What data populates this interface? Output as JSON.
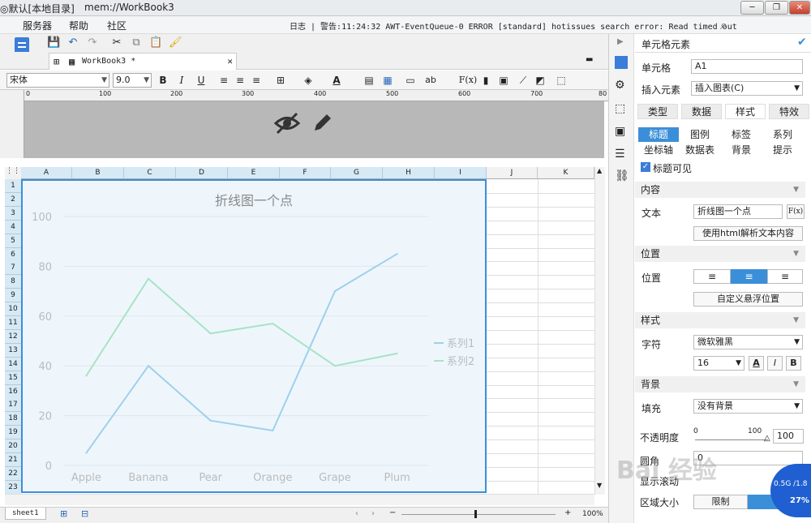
{
  "window": {
    "title": "◎默认[本地目录]",
    "path": "mem://WorkBook3"
  },
  "menu": {
    "items": [
      "服务器",
      "帮助",
      "社区"
    ],
    "log": "日志 | 警告:11:24:32 AWT-EventQueue-0 ERROR [standard] hotissues search error: Read timed out"
  },
  "tab": {
    "label": "WorkBook3 *"
  },
  "format": {
    "font": "宋体",
    "size": "9.0",
    "bold": "B",
    "italic": "I",
    "underline": "U",
    "text_color_label": "A",
    "ab_label": "ab",
    "formula_label": "F(x)"
  },
  "ruler": {
    "ticks": [
      "0",
      "100",
      "200",
      "300",
      "400",
      "500",
      "600",
      "700",
      "80"
    ]
  },
  "columns": [
    "A",
    "B",
    "C",
    "D",
    "E",
    "F",
    "G",
    "H",
    "I",
    "J",
    "K"
  ],
  "rows": [
    "1",
    "2",
    "3",
    "4",
    "5",
    "6",
    "7",
    "8",
    "9",
    "10",
    "11",
    "12",
    "13",
    "14",
    "15",
    "16",
    "17",
    "18",
    "19",
    "20",
    "21",
    "22",
    "23"
  ],
  "status": {
    "sheet_name": "sheet1",
    "zoom": "100%"
  },
  "colors": {
    "accent": "#3b8fd8",
    "series1": "#9fd0ec",
    "series2": "#a7e3c4",
    "selected_tab": "#3b8fd8"
  },
  "chart_data": {
    "type": "line",
    "title": "折线图一个点",
    "categories": [
      "Apple",
      "Banana",
      "Pear",
      "Orange",
      "Grape",
      "Plum"
    ],
    "series": [
      {
        "name": "系列1",
        "values": [
          5,
          40,
          18,
          14,
          70,
          85
        ]
      },
      {
        "name": "系列2",
        "values": [
          36,
          75,
          53,
          57,
          40,
          45
        ]
      }
    ],
    "ylim": [
      0,
      100
    ],
    "yticks": [
      "0",
      "20",
      "40",
      "60",
      "80",
      "100"
    ],
    "grid": true,
    "legend": "right"
  },
  "panel": {
    "title": "单元格元素",
    "cell_label": "单元格",
    "cell_value": "A1",
    "insert_label": "插入元素",
    "insert_value": "插入图表(C)",
    "main_tabs": [
      "类型",
      "数据",
      "样式",
      "特效"
    ],
    "sub_tabs": [
      "标题",
      "图例",
      "标签",
      "系列",
      "坐标轴",
      "数据表",
      "背景",
      "提示"
    ],
    "title_visible": "标题可见",
    "content_section": "内容",
    "text_label": "文本",
    "text_value": "折线图一个点",
    "fx_label": "F(x)",
    "html_button": "使用html解析文本内容",
    "position_section": "位置",
    "position_label": "位置",
    "custom_pos_button": "自定义悬浮位置",
    "style_section": "样式",
    "char_label": "字符",
    "font_value": "微软雅黑",
    "size_value": "16",
    "color_btn": "A",
    "italic_btn": "I",
    "bold_btn": "B",
    "bg_section": "背景",
    "fill_label": "填充",
    "fill_value": "没有背景",
    "opacity_label": "不透明度",
    "opacity_min": "0",
    "opacity_max": "100",
    "opacity_value": "100",
    "corner_label": "圆角",
    "corner_value": "0",
    "show_label": "显示滚动",
    "area_label": "区域大小",
    "area_btn": "限制"
  },
  "widget": {
    "memory": "0.5G /1.8",
    "percent": "27%"
  },
  "watermark": "Bai 经验"
}
